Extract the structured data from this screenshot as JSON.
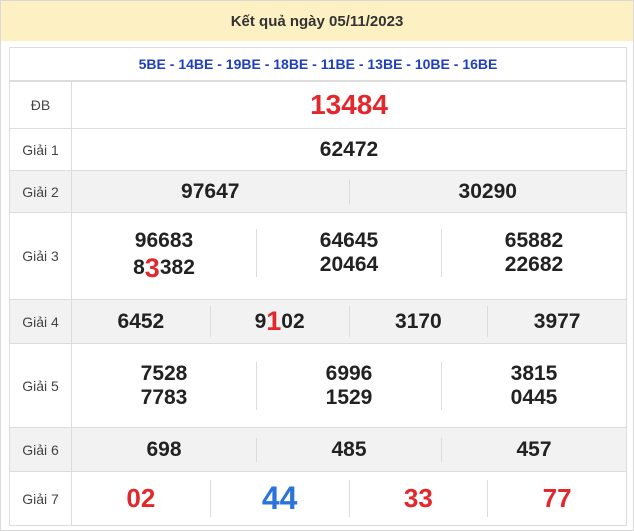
{
  "title": "Kết quả ngày 05/11/2023",
  "codes": "5BE - 14BE - 19BE - 18BE - 11BE - 13BE - 10BE - 16BE",
  "rows": {
    "db": {
      "label": "ĐB",
      "value": "13484"
    },
    "g1": {
      "label": "Giải 1",
      "value": "62472"
    },
    "g2": {
      "label": "Giải 2",
      "values": [
        "97647",
        "30290"
      ]
    },
    "g3": {
      "label": "Giải 3",
      "values": [
        "96683",
        "64645",
        "65882",
        "83382",
        "20464",
        "22682"
      ]
    },
    "g4": {
      "label": "Giải 4",
      "values": [
        "6452",
        "9102",
        "3170",
        "3977"
      ]
    },
    "g5": {
      "label": "Giải 5",
      "values": [
        "7528",
        "6996",
        "3815",
        "7783",
        "1529",
        "0445"
      ]
    },
    "g6": {
      "label": "Giải 6",
      "values": [
        "698",
        "485",
        "457"
      ]
    },
    "g7": {
      "label": "Giải 7",
      "values": [
        "02",
        "44",
        "33",
        "77"
      ]
    }
  },
  "colors": {
    "title_bg": "#fdf1c4",
    "codes_text": "#1f3fbf",
    "highlight_red": "#e2282c",
    "highlight_blue": "#2a74d9"
  }
}
